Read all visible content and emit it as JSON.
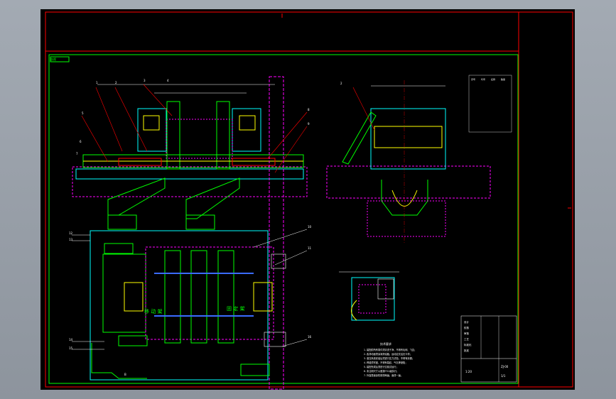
{
  "colors": {
    "background": "#000000",
    "frame": "#ff0000",
    "inner_frame": "#00ff00",
    "outline": "#00ffff",
    "hidden_line": "#ff00ff",
    "parts": "#ffff00",
    "text": "#ffffff",
    "accent_blue": "#3a6bff"
  },
  "drawing": {
    "labels": {
      "upper_center": "剖视",
      "lower_middle": "固 定 架",
      "lower_left": "移 动 架"
    },
    "callouts": {
      "left": [
        "1",
        "2",
        "3",
        "4",
        "5",
        "6",
        "7"
      ],
      "right": [
        "8",
        "9",
        "10",
        "11"
      ],
      "bottom": [
        "12",
        "13",
        "14",
        "15",
        "16"
      ],
      "side_view": [
        "2",
        "B"
      ]
    },
    "notes_title": "技术要求",
    "notes": [
      "1. 装配前所有零件须清洗干净，不得有毛刺、飞边；",
      "2. 各滑动面须涂润滑油脂，运动应灵活无卡滞；",
      "3. 液压系统安装后须进行压力试验，不得有渗漏；",
      "4. 焊缝须牢固，不得有裂纹、气孔等缺陷；",
      "5. 装配完成后须进行空载试运行；",
      "6. 未注明尺寸公差按IT12级执行；",
      "7. 外露表面涂防锈漆两遍，面漆一遍。"
    ],
    "title_block": {
      "rows": [
        "设计",
        "校核",
        "审核",
        "工艺",
        "标准化",
        "批准"
      ],
      "drawing_no": "ZJ-00",
      "scale": "1:20",
      "sheet": "1/1"
    },
    "parts_list_header": [
      "序号",
      "代号",
      "名称",
      "数量"
    ]
  }
}
